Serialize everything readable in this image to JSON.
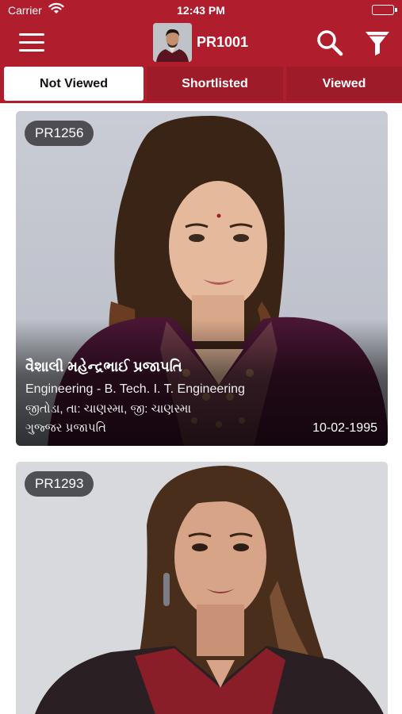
{
  "status_bar": {
    "carrier": "Carrier",
    "time": "12:43 PM"
  },
  "header": {
    "profile_id": "PR1001",
    "menu_icon": "hamburger-menu-icon",
    "search_icon": "search-icon",
    "filter_icon": "filter-icon"
  },
  "tabs": [
    {
      "label": "Not Viewed",
      "active": true
    },
    {
      "label": "Shortlisted",
      "active": false
    },
    {
      "label": "Viewed",
      "active": false
    }
  ],
  "profiles": [
    {
      "id": "PR1256",
      "name": "વૈશાલી મહેન્દ્રભાઈ પ્રજાપતિ",
      "education": "Engineering - B. Tech. I. T. Engineering",
      "place": "જીતોડા, તા: ચાણસ્મા, જી: ચાણસ્મા",
      "caste": "ગુજ્જર પ્રજાપતિ",
      "dob": "10-02-1995"
    },
    {
      "id": "PR1293"
    }
  ],
  "colors": {
    "brand": "#b01e2e",
    "tab_inactive": "#9e1b29"
  }
}
